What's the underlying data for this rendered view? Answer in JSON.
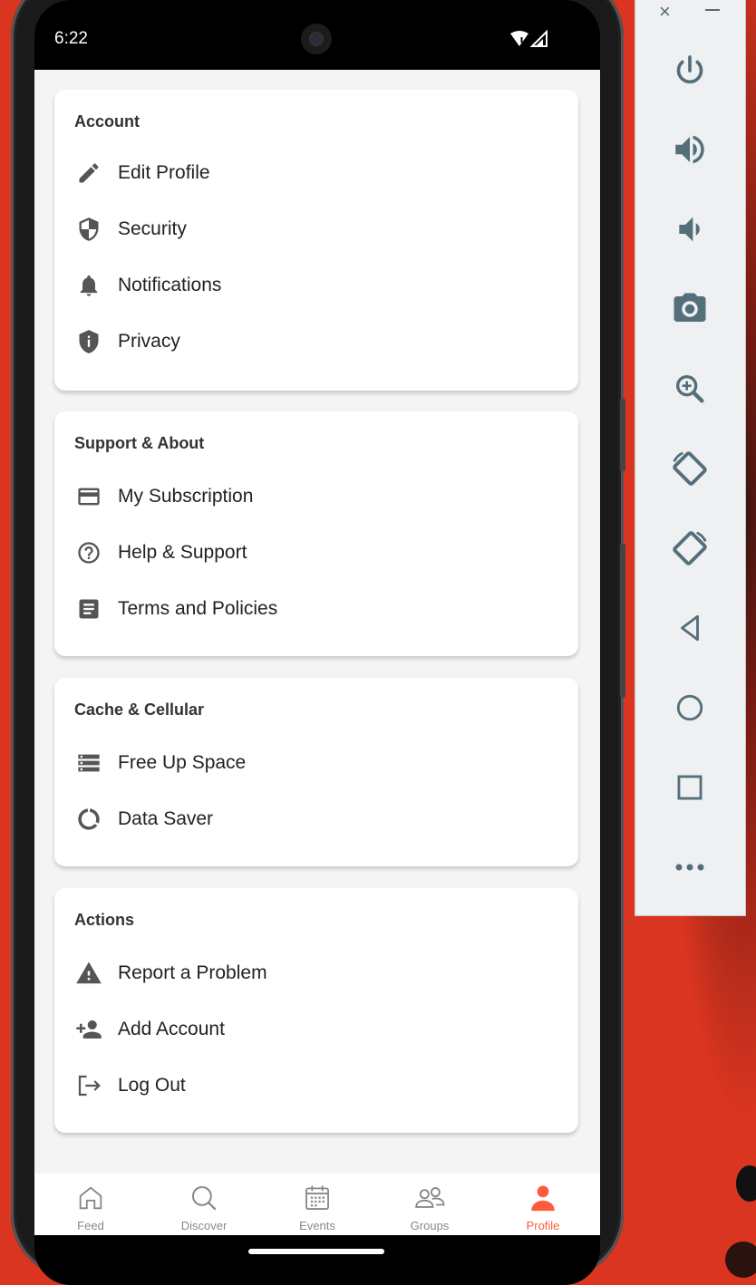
{
  "status_bar": {
    "time": "6:22"
  },
  "sections": [
    {
      "title": "Account",
      "items": [
        {
          "label": "Edit Profile",
          "icon": "pencil-icon"
        },
        {
          "label": "Security",
          "icon": "shield-icon"
        },
        {
          "label": "Notifications",
          "icon": "bell-icon"
        },
        {
          "label": "Privacy",
          "icon": "shield-info-icon"
        }
      ]
    },
    {
      "title": "Support & About",
      "items": [
        {
          "label": "My Subscription",
          "icon": "credit-card-icon"
        },
        {
          "label": "Help & Support",
          "icon": "help-circle-icon"
        },
        {
          "label": "Terms and Policies",
          "icon": "document-icon"
        }
      ]
    },
    {
      "title": "Cache & Cellular",
      "items": [
        {
          "label": "Free Up Space",
          "icon": "storage-icon"
        },
        {
          "label": "Data Saver",
          "icon": "data-saver-icon"
        }
      ]
    },
    {
      "title": "Actions",
      "items": [
        {
          "label": "Report a Problem",
          "icon": "warning-icon"
        },
        {
          "label": "Add Account",
          "icon": "add-person-icon"
        },
        {
          "label": "Log Out",
          "icon": "logout-icon"
        }
      ]
    }
  ],
  "tabs": [
    {
      "label": "Feed",
      "icon": "home-icon",
      "active": false
    },
    {
      "label": "Discover",
      "icon": "search-icon",
      "active": false
    },
    {
      "label": "Events",
      "icon": "calendar-icon",
      "active": false
    },
    {
      "label": "Groups",
      "icon": "groups-icon",
      "active": false
    },
    {
      "label": "Profile",
      "icon": "person-icon",
      "active": true
    }
  ],
  "emulator_toolbar": {
    "buttons": [
      "power-icon",
      "volume-up-icon",
      "volume-down-icon",
      "camera-icon",
      "zoom-icon",
      "rotate-left-icon",
      "rotate-right-icon",
      "back-icon",
      "home-circle-icon",
      "overview-icon",
      "more-icon"
    ]
  },
  "colors": {
    "accent": "#ff5a3c",
    "icon_gray": "#555555",
    "toolbar_icon": "#546e7a",
    "background": "#d93520"
  }
}
